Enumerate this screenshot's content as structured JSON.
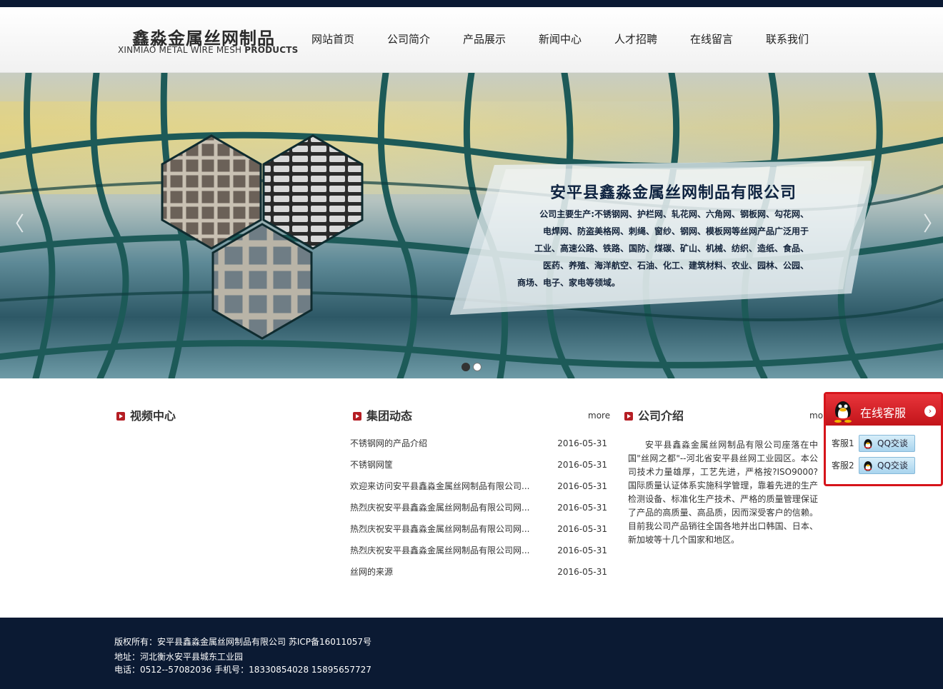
{
  "header": {
    "logo_cn": "鑫淼金属丝网制品",
    "logo_en_prefix": "XINMIAO METAL WIRE MESH",
    "logo_en_bold": "PRODUCTS",
    "nav": [
      "网站首页",
      "公司简介",
      "产品展示",
      "新闻中心",
      "人才招聘",
      "在线留言",
      "联系我们"
    ]
  },
  "banner": {
    "title": "安平县鑫淼金属丝网制品有限公司",
    "lines": [
      "公司主要生产:不锈钢网、护栏网、轧花网、六角网、钢板网、勾花网、",
      "电焊网、防盗美格网、刺绳、窗纱、钢网、模板网等丝网产品广泛用于",
      "工业、高速公路、铁路、国防、煤碳、矿山、机械、纺织、造纸、食品、",
      "医药、养殖、海洋航空、石油、化工、建筑材料、农业、园林、公园、",
      "商场、电子、家电等领域。"
    ],
    "prev_glyph": "〈",
    "next_glyph": "〉",
    "slide_count": 2,
    "active_slide": 1
  },
  "video": {
    "title": "视频中心"
  },
  "news": {
    "title": "集团动态",
    "more": "more",
    "items": [
      {
        "title": "不锈钢网的产品介绍",
        "date": "2016-05-31"
      },
      {
        "title": "不锈钢网筐",
        "date": "2016-05-31"
      },
      {
        "title": "欢迎来访问安平县鑫淼金属丝网制品有限公司...",
        "date": "2016-05-31"
      },
      {
        "title": "热烈庆祝安平县鑫淼金属丝网制品有限公司网...",
        "date": "2016-05-31"
      },
      {
        "title": "热烈庆祝安平县鑫淼金属丝网制品有限公司网...",
        "date": "2016-05-31"
      },
      {
        "title": "热烈庆祝安平县鑫淼金属丝网制品有限公司网...",
        "date": "2016-05-31"
      },
      {
        "title": "丝网的来源",
        "date": "2016-05-31"
      }
    ]
  },
  "about": {
    "title": "公司介绍",
    "more": "mor",
    "text": "安平县鑫淼金属丝网制品有限公司座落在中国\"丝网之都\"--河北省安平县丝网工业园区。本公司技术力量雄厚，工艺先进，严格按?ISO9000?国际质量认证体系实施科学管理，靠着先进的生产检测设备、标准化生产技术、严格的质量管理保证了产品的高质量、高品质，因而深受客户的信赖。目前我公司产品销往全国各地并出口韩国、日本、新加坡等十几个国家和地区。"
  },
  "footer": {
    "copyright": "版权所有：安平县鑫淼金属丝网制品有限公司  苏ICP备16011057号",
    "address": "地址：河北衡水安平县城东工业园",
    "phone": "电话：0512--57082036 手机号：18330854028 15895657727"
  },
  "kefu": {
    "title": "在线客服",
    "close_glyph": "›",
    "agents": [
      {
        "label": "客服1",
        "button": "QQ交谈"
      },
      {
        "label": "客服2",
        "button": "QQ交谈"
      }
    ]
  },
  "colors": {
    "dark_navy": "#0b1a33",
    "accent_red": "#b51e24",
    "kefu_red": "#d6141b"
  }
}
